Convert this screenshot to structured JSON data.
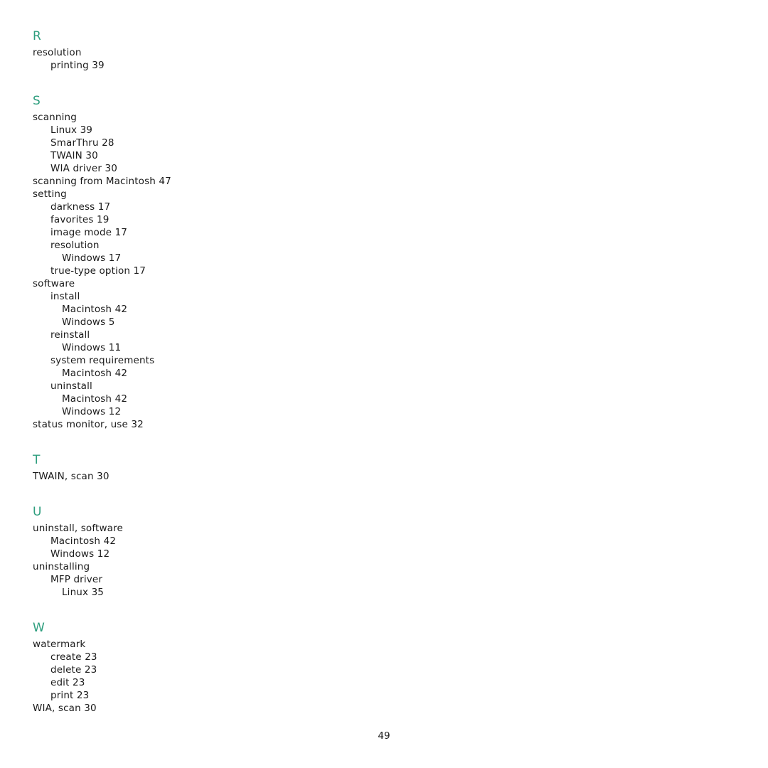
{
  "document": {
    "type": "index",
    "page_number": "49",
    "heading_color": "#2e9e7e",
    "text_color": "#1a1a1a",
    "background_color": "#ffffff"
  },
  "sections": [
    {
      "letter": "R",
      "entries": [
        {
          "level": 0,
          "text": "resolution"
        },
        {
          "level": 1,
          "text": "printing 39"
        }
      ]
    },
    {
      "letter": "S",
      "entries": [
        {
          "level": 0,
          "text": "scanning"
        },
        {
          "level": 1,
          "text": "Linux 39"
        },
        {
          "level": 1,
          "text": "SmarThru 28"
        },
        {
          "level": 1,
          "text": "TWAIN 30"
        },
        {
          "level": 1,
          "text": "WIA driver 30"
        },
        {
          "level": 0,
          "text": "scanning from Macintosh 47"
        },
        {
          "level": 0,
          "text": "setting"
        },
        {
          "level": 1,
          "text": "darkness 17"
        },
        {
          "level": 1,
          "text": "favorites 19"
        },
        {
          "level": 1,
          "text": "image mode 17"
        },
        {
          "level": 1,
          "text": "resolution"
        },
        {
          "level": 2,
          "text": "Windows 17"
        },
        {
          "level": 1,
          "text": "true-type option 17"
        },
        {
          "level": 0,
          "text": "software"
        },
        {
          "level": 1,
          "text": "install"
        },
        {
          "level": 2,
          "text": "Macintosh 42"
        },
        {
          "level": 2,
          "text": "Windows 5"
        },
        {
          "level": 1,
          "text": "reinstall"
        },
        {
          "level": 2,
          "text": "Windows 11"
        },
        {
          "level": 1,
          "text": "system requirements"
        },
        {
          "level": 2,
          "text": "Macintosh 42"
        },
        {
          "level": 1,
          "text": "uninstall"
        },
        {
          "level": 2,
          "text": "Macintosh 42"
        },
        {
          "level": 2,
          "text": "Windows 12"
        },
        {
          "level": 0,
          "text": "status monitor, use 32"
        }
      ]
    },
    {
      "letter": "T",
      "entries": [
        {
          "level": 0,
          "text": "TWAIN, scan 30"
        }
      ]
    },
    {
      "letter": "U",
      "entries": [
        {
          "level": 0,
          "text": "uninstall, software"
        },
        {
          "level": 1,
          "text": "Macintosh 42"
        },
        {
          "level": 1,
          "text": "Windows 12"
        },
        {
          "level": 0,
          "text": "uninstalling"
        },
        {
          "level": 1,
          "text": "MFP driver"
        },
        {
          "level": 2,
          "text": "Linux 35"
        }
      ]
    },
    {
      "letter": "W",
      "entries": [
        {
          "level": 0,
          "text": "watermark"
        },
        {
          "level": 1,
          "text": "create 23"
        },
        {
          "level": 1,
          "text": "delete 23"
        },
        {
          "level": 1,
          "text": "edit 23"
        },
        {
          "level": 1,
          "text": "print 23"
        },
        {
          "level": 0,
          "text": "WIA, scan 30"
        }
      ]
    }
  ]
}
